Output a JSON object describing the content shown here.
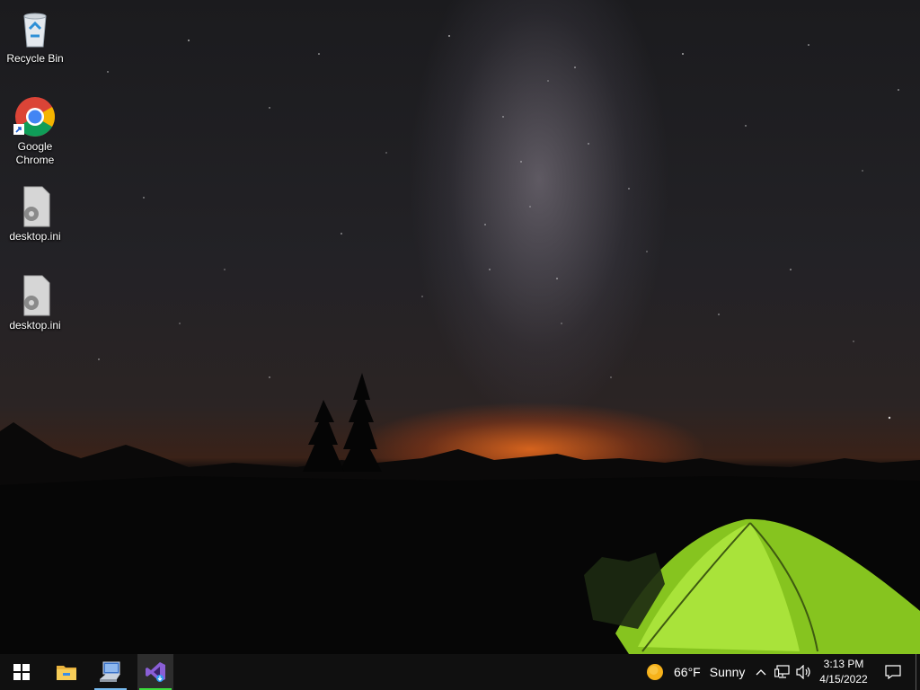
{
  "desktop": {
    "icons": [
      {
        "label": "Recycle Bin",
        "icon": "recycle-bin-icon"
      },
      {
        "label": "Google\nChrome",
        "icon": "chrome-icon"
      },
      {
        "label": "desktop.ini",
        "icon": "settings-file-icon"
      },
      {
        "label": "desktop.ini",
        "icon": "settings-file-icon"
      }
    ]
  },
  "taskbar": {
    "apps": [
      {
        "name": "start",
        "icon": "windows-logo-icon"
      },
      {
        "name": "file-explorer",
        "icon": "folder-icon"
      },
      {
        "name": "remote-desktop",
        "icon": "monitor-icon"
      },
      {
        "name": "visual-studio",
        "icon": "visual-studio-icon"
      }
    ],
    "weather": {
      "temp": "66°F",
      "condition": "Sunny",
      "icon": "sun-icon"
    },
    "clock": {
      "time": "3:13 PM",
      "date": "4/15/2022"
    }
  },
  "colors": {
    "taskbar": "#101010",
    "underline": "#76b9ed",
    "vs_active": "#3ddc3d",
    "tent": "#a6e22e"
  }
}
